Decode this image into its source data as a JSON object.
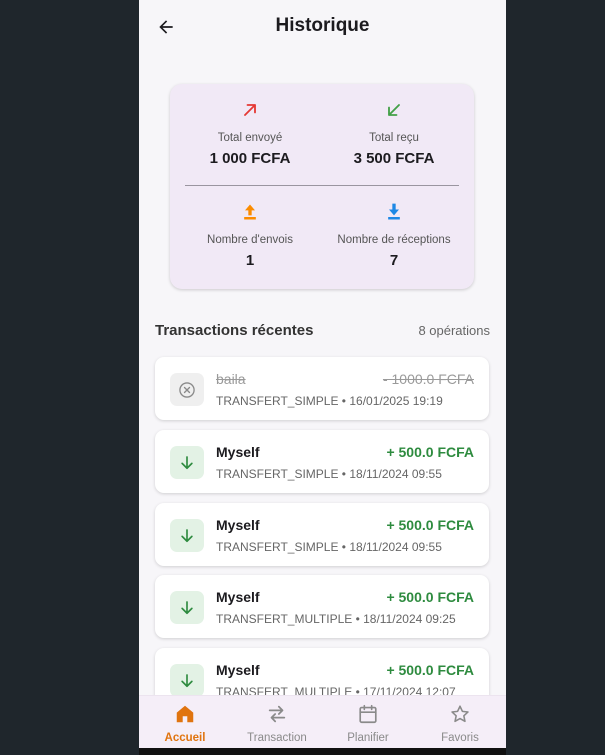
{
  "header": {
    "title": "Historique"
  },
  "summary": {
    "sent": {
      "label": "Total envoyé",
      "value": "1 000 FCFA",
      "color": "#e53935"
    },
    "received": {
      "label": "Total reçu",
      "value": "3 500 FCFA",
      "color": "#43a047"
    },
    "sends_count": {
      "label": "Nombre d'envois",
      "value": "1",
      "color": "#fb8c00"
    },
    "receptions_count": {
      "label": "Nombre de réceptions",
      "value": "7",
      "color": "#1e88e5"
    }
  },
  "transactions": {
    "title": "Transactions récentes",
    "count": "8 opérations",
    "items": [
      {
        "name": "baila",
        "amount": "- 1000.0 FCFA",
        "meta": "TRANSFERT_SIMPLE • 16/01/2025 19:19",
        "status": "cancelled"
      },
      {
        "name": "Myself",
        "amount": "+ 500.0 FCFA",
        "meta": "TRANSFERT_SIMPLE • 18/11/2024 09:55",
        "status": "received"
      },
      {
        "name": "Myself",
        "amount": "+ 500.0 FCFA",
        "meta": "TRANSFERT_SIMPLE • 18/11/2024 09:55",
        "status": "received"
      },
      {
        "name": "Myself",
        "amount": "+ 500.0 FCFA",
        "meta": "TRANSFERT_MULTIPLE • 18/11/2024 09:25",
        "status": "received"
      },
      {
        "name": "Myself",
        "amount": "+ 500.0 FCFA",
        "meta": "TRANSFERT_MULTIPLE • 17/11/2024 12:07",
        "status": "received"
      }
    ]
  },
  "nav": {
    "items": [
      {
        "label": "Accueil",
        "icon": "home-icon",
        "active": true
      },
      {
        "label": "Transaction",
        "icon": "swap-icon",
        "active": false
      },
      {
        "label": "Planifier",
        "icon": "calendar-icon",
        "active": false
      },
      {
        "label": "Favoris",
        "icon": "star-icon",
        "active": false
      }
    ],
    "active_color": "#e0740f"
  }
}
